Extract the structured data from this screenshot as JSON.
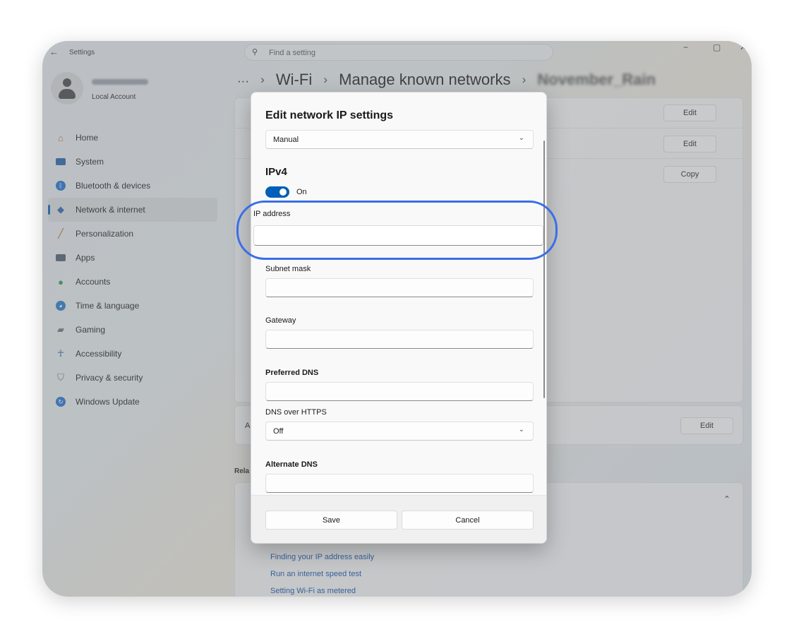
{
  "window": {
    "title": "Settings",
    "search_placeholder": "Find a setting",
    "controls": {
      "minimize": "−",
      "maximize": "▢",
      "close": "✕"
    }
  },
  "profile": {
    "account_type": "Local Account"
  },
  "nav": {
    "items": [
      {
        "label": "Home",
        "icon": "home-icon",
        "color": "#c46a2b"
      },
      {
        "label": "System",
        "icon": "system-icon",
        "color": "#1f5fa8"
      },
      {
        "label": "Bluetooth & devices",
        "icon": "bluetooth-icon",
        "color": "#1c6fd1"
      },
      {
        "label": "Network & internet",
        "icon": "network-icon",
        "color": "#2b5fae",
        "active": true
      },
      {
        "label": "Personalization",
        "icon": "brush-icon",
        "color": "#b5651d"
      },
      {
        "label": "Apps",
        "icon": "apps-icon",
        "color": "#4a5a6e"
      },
      {
        "label": "Accounts",
        "icon": "accounts-icon",
        "color": "#2e9a4a"
      },
      {
        "label": "Time & language",
        "icon": "globe-icon",
        "color": "#2278c9"
      },
      {
        "label": "Gaming",
        "icon": "gamepad-icon",
        "color": "#6b7380"
      },
      {
        "label": "Accessibility",
        "icon": "accessibility-icon",
        "color": "#1a5aa0"
      },
      {
        "label": "Privacy & security",
        "icon": "shield-icon",
        "color": "#6b7380"
      },
      {
        "label": "Windows Update",
        "icon": "update-icon",
        "color": "#1d6fd0"
      }
    ]
  },
  "breadcrumb": {
    "dots": "···",
    "sep": "›",
    "items": [
      "Wi-Fi",
      "Manage known networks",
      "November_Rain"
    ]
  },
  "background": {
    "row_buttons": [
      "Edit",
      "Edit",
      "Copy"
    ],
    "second_edit": "Edit",
    "related_label": "Rela",
    "card_prefix": "A",
    "related_links": [
      "Finding your IP address easily",
      "Run an internet speed test",
      "Setting Wi-Fi as metered"
    ]
  },
  "dialog": {
    "title": "Edit network IP settings",
    "mode_value": "Manual",
    "ipv4_heading": "IPv4",
    "ipv4_toggle_label": "On",
    "ipv4_toggle_on": true,
    "fields": {
      "ip_address": "IP address",
      "subnet_mask": "Subnet mask",
      "gateway": "Gateway",
      "preferred_dns": "Preferred DNS",
      "dns_over_https": "DNS over HTTPS",
      "dns_over_https_value": "Off",
      "alternate_dns": "Alternate DNS"
    },
    "save_label": "Save",
    "cancel_label": "Cancel"
  },
  "colors": {
    "accent": "#005fb8",
    "highlight_ring": "#3a6ee8",
    "link": "#0a4fa8"
  }
}
